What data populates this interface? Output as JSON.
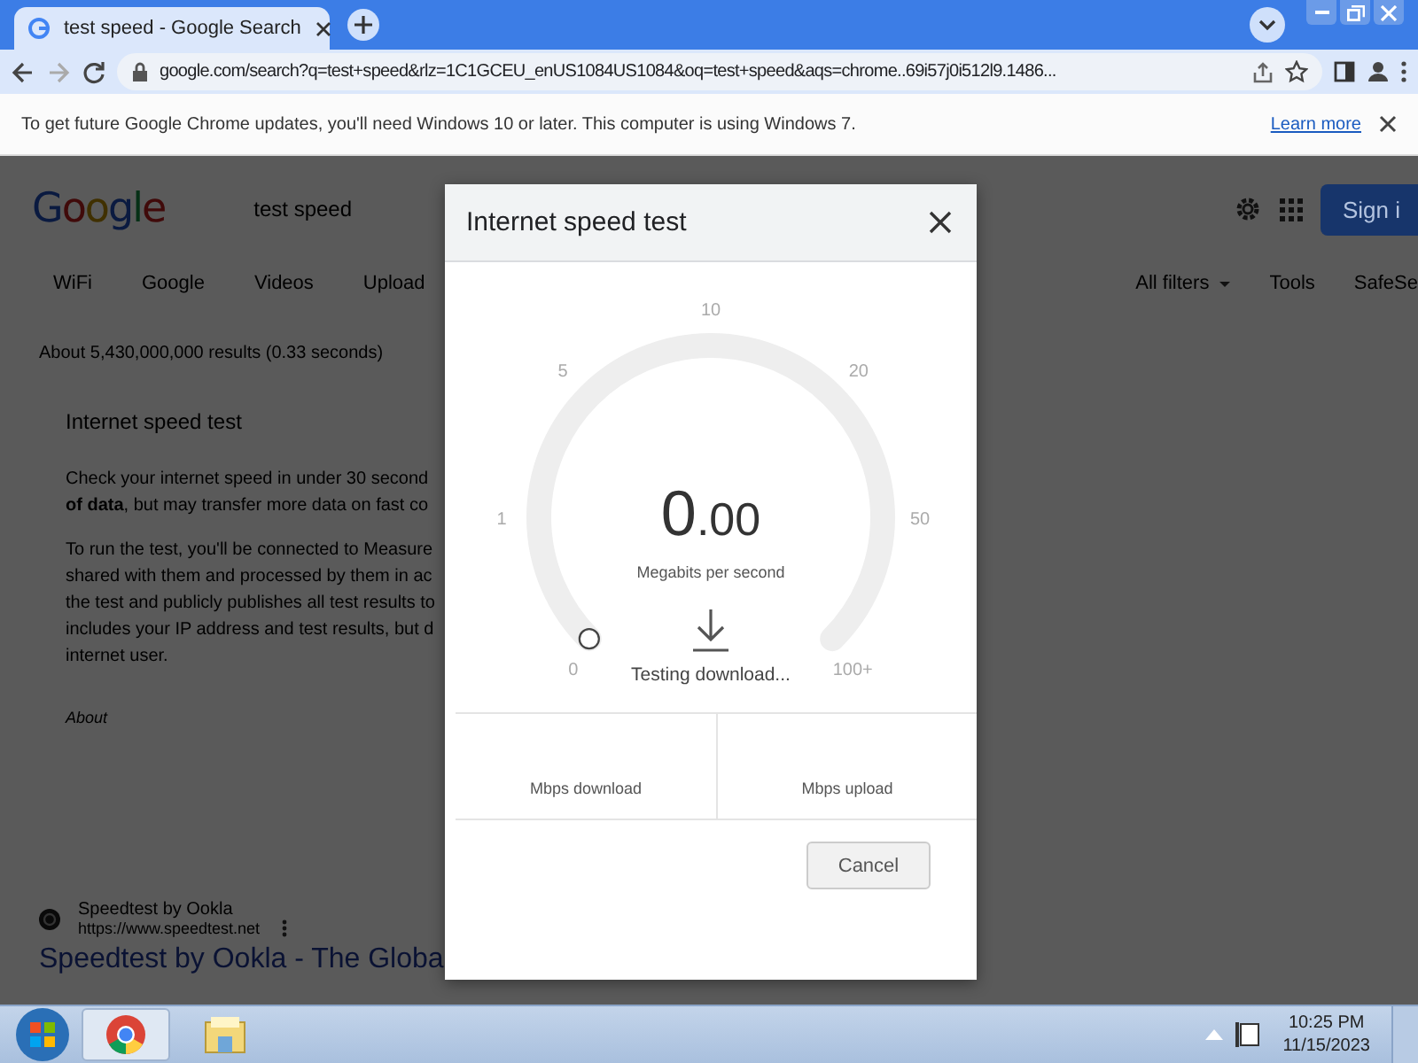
{
  "browser": {
    "tabs": [
      {
        "title": "test speed - Google Search",
        "selected": true
      }
    ],
    "address": "google.com/search?q=test+speed&rlz=1C1GCEU_enUS1084US1084&oq=test+speed&aqs=chrome..69i57j0i512l9.1486...",
    "infobar": {
      "message": "To get future Google Chrome updates, you'll need Windows 10 or later. This computer is using Windows 7.",
      "link": "Learn more"
    }
  },
  "search_page": {
    "logo": "Google",
    "query": "test speed",
    "sign_in": "Sign i",
    "chips": [
      "WiFi",
      "Google",
      "Videos",
      "Upload"
    ],
    "right_tools": [
      "All filters",
      "Tools",
      "SafeSe"
    ],
    "stats": "About 5,430,000,000 results (0.33 seconds)",
    "card": {
      "title": "Internet speed test",
      "paragraphs": [
        [
          "Check your internet speed in under 30 second",
          "**of data**, but may transfer more data on fast co"
        ],
        [
          "To run the test, you'll be connected to Measure",
          "shared with them and processed by them in ac",
          "the test and publicly publishes all test results to",
          "includes your IP address and test results, but d",
          "internet user."
        ]
      ],
      "about": "About"
    },
    "result": {
      "site": "Speedtest by Ookla",
      "url": "https://www.speedtest.net",
      "title": "Speedtest by Ookla - The Globa"
    }
  },
  "dialog": {
    "title": "Internet speed test",
    "scale": [
      "0",
      "1",
      "5",
      "10",
      "20",
      "50",
      "100+"
    ],
    "gauge": {
      "value_whole": "0",
      "value_fraction": ".00",
      "unit": "Megabits per second",
      "status": "Testing download..."
    },
    "results": [
      "Mbps download",
      "Mbps upload"
    ],
    "cancel": "Cancel"
  },
  "taskbar": {
    "time": "10:25 PM",
    "date": "11/15/2023"
  }
}
